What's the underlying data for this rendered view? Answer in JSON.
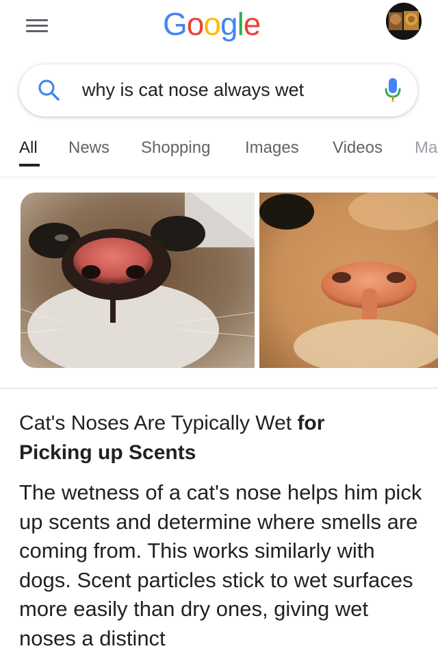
{
  "header": {
    "logo_letters": [
      "G",
      "o",
      "o",
      "g",
      "l",
      "e"
    ],
    "menu_icon": "hamburger-menu-icon",
    "avatar_icon": "user-avatar"
  },
  "search": {
    "query": "why is cat nose always wet",
    "search_icon": "search-icon",
    "mic_icon": "microphone-icon"
  },
  "tabs": [
    {
      "label": "All",
      "active": true
    },
    {
      "label": "News",
      "active": false
    },
    {
      "label": "Shopping",
      "active": false
    },
    {
      "label": "Images",
      "active": false
    },
    {
      "label": "Videos",
      "active": false
    },
    {
      "label": "Ma",
      "active": false
    }
  ],
  "images": [
    {
      "subject": "close-up of a pink cat nose with whiskers"
    },
    {
      "subject": "close-up of an orange cat nose"
    }
  ],
  "answer": {
    "title_regular": "Cat's Noses Are Typically Wet ",
    "title_bold_1": "for",
    "title_bold_2": "Picking up Scents",
    "body": "The wetness of a cat's nose helps him pick up scents and determine where smells are coming from. This works similarly with dogs. Scent particles stick to wet surfaces more easily than dry ones, giving wet noses a distinct"
  },
  "colors": {
    "google_blue": "#4285F4",
    "google_red": "#EA4335",
    "google_yellow": "#FBBC05",
    "google_green": "#34A853",
    "text_primary": "#202124",
    "text_secondary": "#5f6368"
  }
}
